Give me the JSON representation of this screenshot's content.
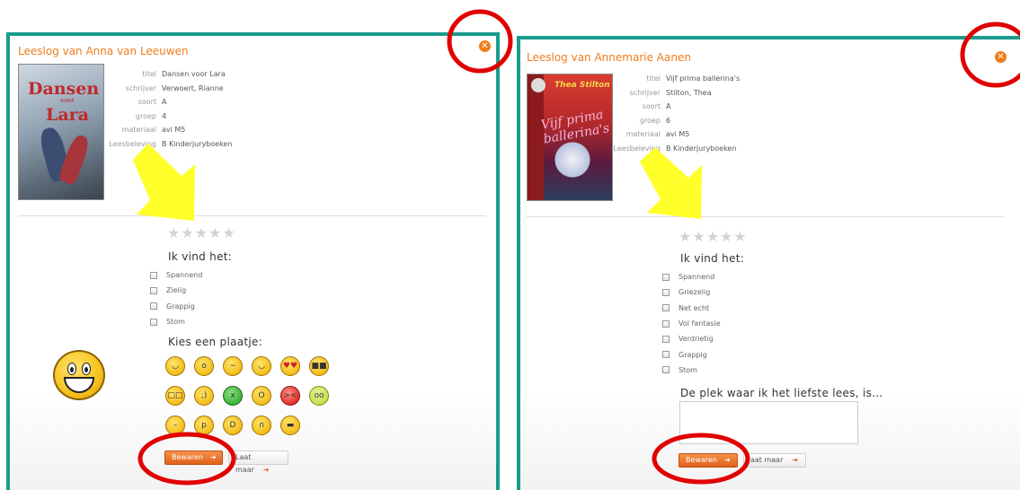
{
  "left": {
    "title": "Leeslog van Anna van Leeuwen",
    "close_icon": "close-icon",
    "cover": {
      "line1": "Dansen",
      "line2": "voor",
      "line3": "Lara"
    },
    "meta": [
      {
        "key": "titel",
        "value": "Dansen voor Lara"
      },
      {
        "key": "schrijver",
        "value": "Verwoert, Rianne"
      },
      {
        "key": "soort",
        "value": "A"
      },
      {
        "key": "groep",
        "value": "4"
      },
      {
        "key": "materiaal",
        "value": "avi M5"
      },
      {
        "key": "Leesbeleving",
        "value": "B Kinderjuryboeken"
      }
    ],
    "stars": [
      "★",
      "★",
      "★",
      "★",
      "★"
    ],
    "section1": "Ik vind het:",
    "options": [
      "Spannend",
      "Zielig",
      "Grappig",
      "Stom"
    ],
    "section2": "Kies een plaatje:",
    "save_label": "Bewaren",
    "cancel_label": "Laat maar"
  },
  "right": {
    "title": "Leeslog van Annemarie Aanen",
    "close_icon": "close-icon",
    "cover": {
      "line1": "Thea Stilton",
      "line2": "Vijf prima ballerina's"
    },
    "meta": [
      {
        "key": "titel",
        "value": "Vijf prima ballerina's"
      },
      {
        "key": "schrijver",
        "value": "Stilton, Thea"
      },
      {
        "key": "soort",
        "value": "A"
      },
      {
        "key": "groep",
        "value": "6"
      },
      {
        "key": "materiaal",
        "value": "avi M5"
      },
      {
        "key": "Leesbeleving",
        "value": "B Kinderjuryboeken"
      }
    ],
    "stars": [
      "★",
      "★",
      "★",
      "★",
      "★"
    ],
    "section1": "Ik vind het:",
    "options": [
      "Spannend",
      "Griezelig",
      "Net echt",
      "Vol fantasie",
      "Verdrietig",
      "Grappig",
      "Stom"
    ],
    "section2": "De plek waar ik het liefste lees, is...",
    "save_label": "Bewaren",
    "cancel_label": "aat maar"
  },
  "emoji_icons": [
    "smile-emoji-icon",
    "surprised-emoji-icon",
    "confused-emoji-icon",
    "blush-emoji-icon",
    "heart-eyes-emoji-icon",
    "sunglasses-emoji-icon",
    "nerd-emoji-icon",
    "wink-emoji-icon",
    "sick-emoji-icon",
    "shocked-emoji-icon",
    "angry-emoji-icon",
    "lime-emoji-icon",
    "hm-emoji-icon",
    "tongue-emoji-icon",
    "laughing-emoji-icon",
    "sad-emoji-icon",
    "cool-emoji-icon"
  ],
  "colors": {
    "teal_border": "#1a9c8e",
    "orange": "#f07c1d",
    "annotation_red": "#e00000",
    "annotation_yellow": "#ffff2a"
  }
}
